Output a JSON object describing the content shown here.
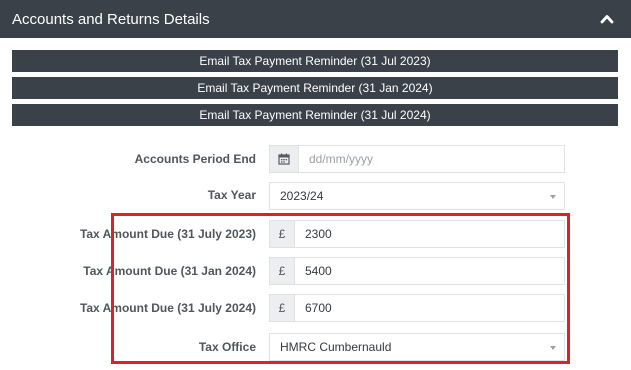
{
  "header": {
    "title": "Accounts and Returns Details",
    "toggle_icon": "chevron-up-icon"
  },
  "reminders": [
    {
      "label": "Email Tax Payment Reminder (31 Jul 2023)"
    },
    {
      "label": "Email Tax Payment Reminder (31 Jan 2024)"
    },
    {
      "label": "Email Tax Payment Reminder (31 Jul 2024)"
    }
  ],
  "form": {
    "accounts_period_end": {
      "label": "Accounts Period End",
      "placeholder": "dd/mm/yyyy",
      "icon": "calendar-icon"
    },
    "tax_year": {
      "label": "Tax Year",
      "value": "2023/24"
    },
    "tax_due_jul_2023": {
      "label": "Tax Amount Due (31 July 2023)",
      "currency": "£",
      "value": "2300"
    },
    "tax_due_jan_2024": {
      "label": "Tax Amount Due (31 Jan 2024)",
      "currency": "£",
      "value": "5400"
    },
    "tax_due_jul_2024": {
      "label": "Tax Amount Due (31 July 2024)",
      "currency": "£",
      "value": "6700"
    },
    "tax_office": {
      "label": "Tax Office",
      "value": "HMRC Cumbernauld"
    }
  },
  "colors": {
    "header_bg": "#3a4149",
    "highlight": "#d8232a"
  }
}
